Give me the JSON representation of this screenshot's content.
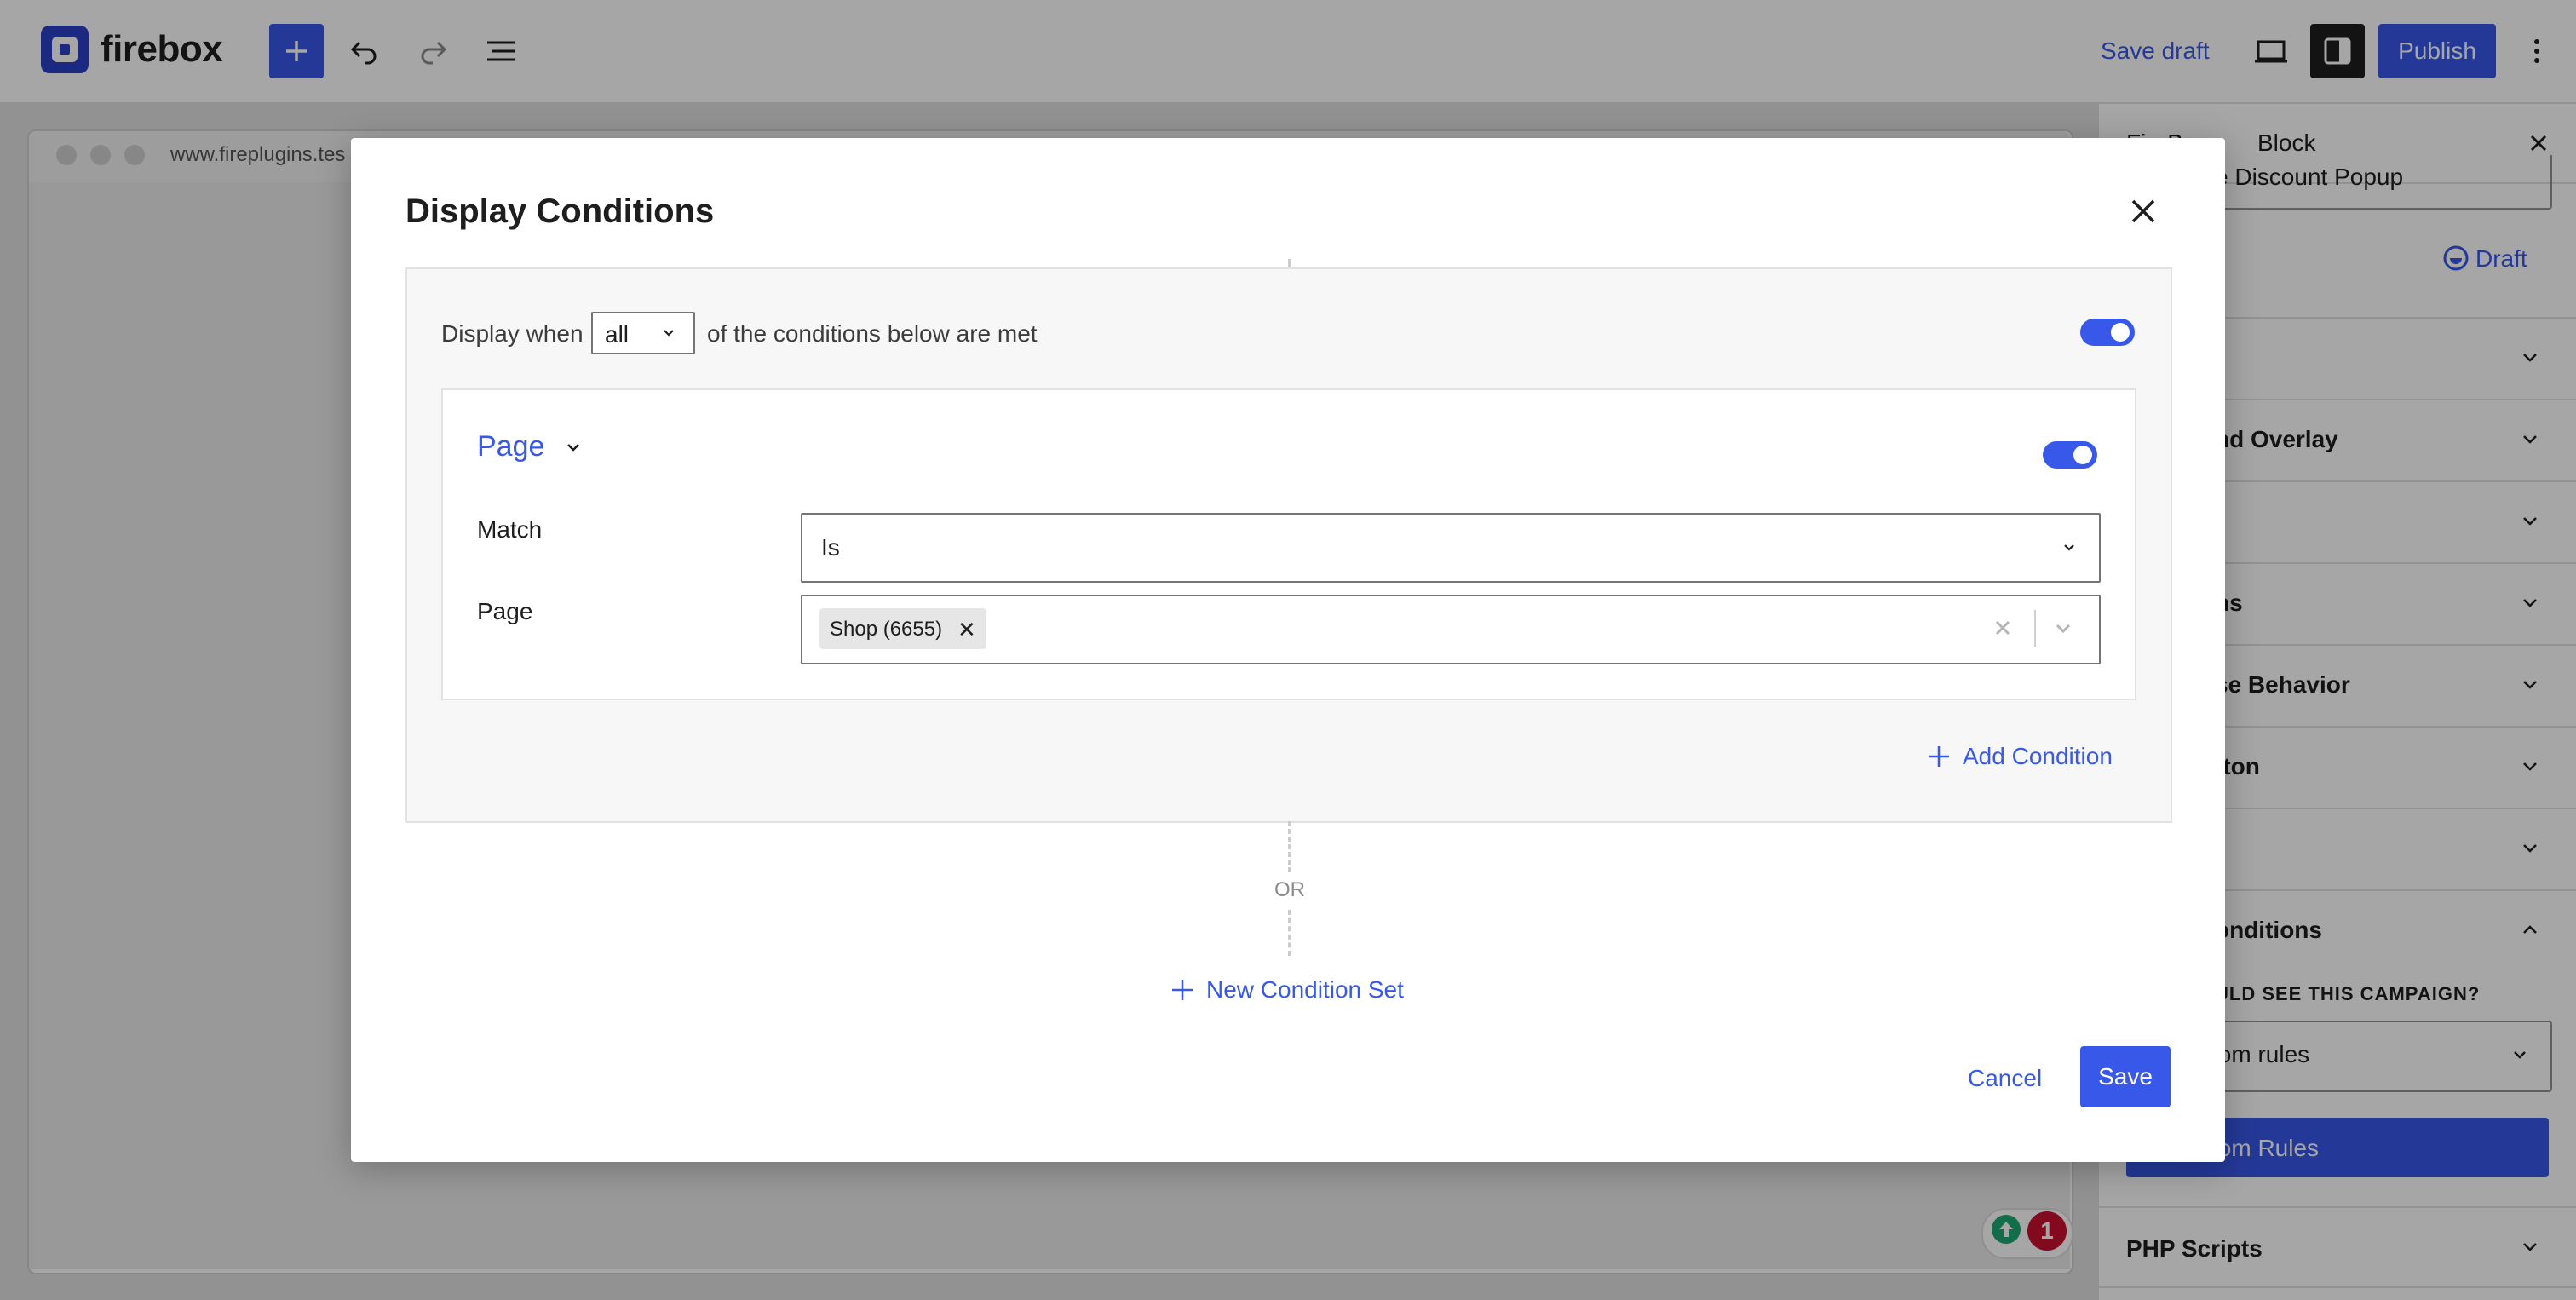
{
  "app": {
    "logo_text": "firebox"
  },
  "toolbar": {
    "save_draft": "Save draft",
    "publish": "Publish",
    "icons": [
      "plus-icon",
      "undo-icon",
      "redo-icon",
      "list-view-icon",
      "desktop-view-icon",
      "settings-panel-icon",
      "more-vertical-icon"
    ]
  },
  "browser": {
    "url": "www.fireplugins.tes"
  },
  "notifications": {
    "count": "1"
  },
  "sidebar": {
    "tabs": [
      "FireBox",
      "Block"
    ],
    "campaign_title": "e Discount Popup",
    "status": "Draft",
    "sections": [
      {
        "label": "",
        "expanded": false
      },
      {
        "label": "nd Overlay",
        "expanded": false
      },
      {
        "label": "",
        "expanded": false
      },
      {
        "label": "ns",
        "expanded": false
      },
      {
        "label": "se Behavior",
        "expanded": false
      },
      {
        "label": "tton",
        "expanded": false
      },
      {
        "label": "",
        "expanded": false
      },
      {
        "label": "onditions",
        "expanded": true
      },
      {
        "label": "PHP Scripts",
        "expanded": false
      }
    ],
    "question": "ULD SEE THIS CAMPAIGN?",
    "rules_select": "tom rules",
    "rules_button": "tom Rules"
  },
  "modal": {
    "title": "Display Conditions",
    "display_when_prefix": "Display when",
    "display_when_value": "all",
    "display_when_suffix": "of the conditions below are met",
    "set_enabled": true,
    "condition": {
      "type": "Page",
      "enabled": true,
      "match_label": "Match",
      "match_value": "Is",
      "page_label": "Page",
      "selected_pages": [
        "Shop (6655)"
      ]
    },
    "add_condition": "Add Condition",
    "or_label": "OR",
    "new_condition_set": "New Condition Set",
    "cancel": "Cancel",
    "save": "Save"
  },
  "colors": {
    "accent": "#3858e9",
    "logo": "#2b3fc7",
    "badge_red": "#c8102e",
    "badge_green": "#1ea672"
  }
}
